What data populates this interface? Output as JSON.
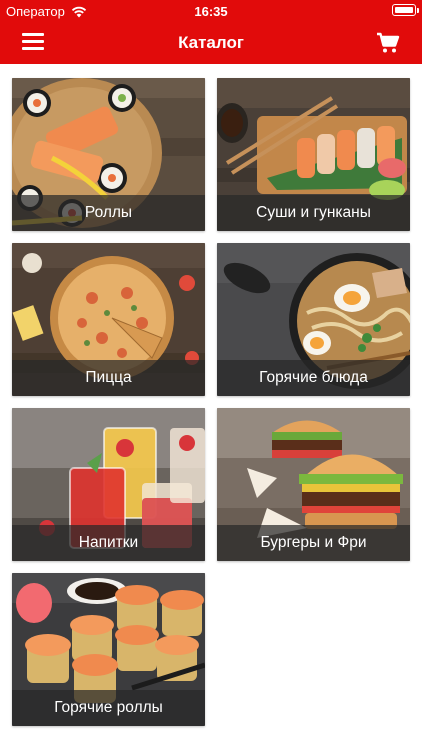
{
  "status_bar": {
    "carrier": "Оператор",
    "time": "16:35"
  },
  "nav": {
    "title": "Каталог",
    "menu_icon": "hamburger-menu-icon",
    "cart_icon": "cart-icon"
  },
  "categories": [
    {
      "label": "Роллы"
    },
    {
      "label": "Суши и гунканы"
    },
    {
      "label": "Пицца"
    },
    {
      "label": "Горячие блюда"
    },
    {
      "label": "Напитки"
    },
    {
      "label": "Бургеры и Фри"
    },
    {
      "label": "Горячие роллы"
    }
  ],
  "colors": {
    "accent": "#e10b0b",
    "caption_bg": "#282828"
  }
}
